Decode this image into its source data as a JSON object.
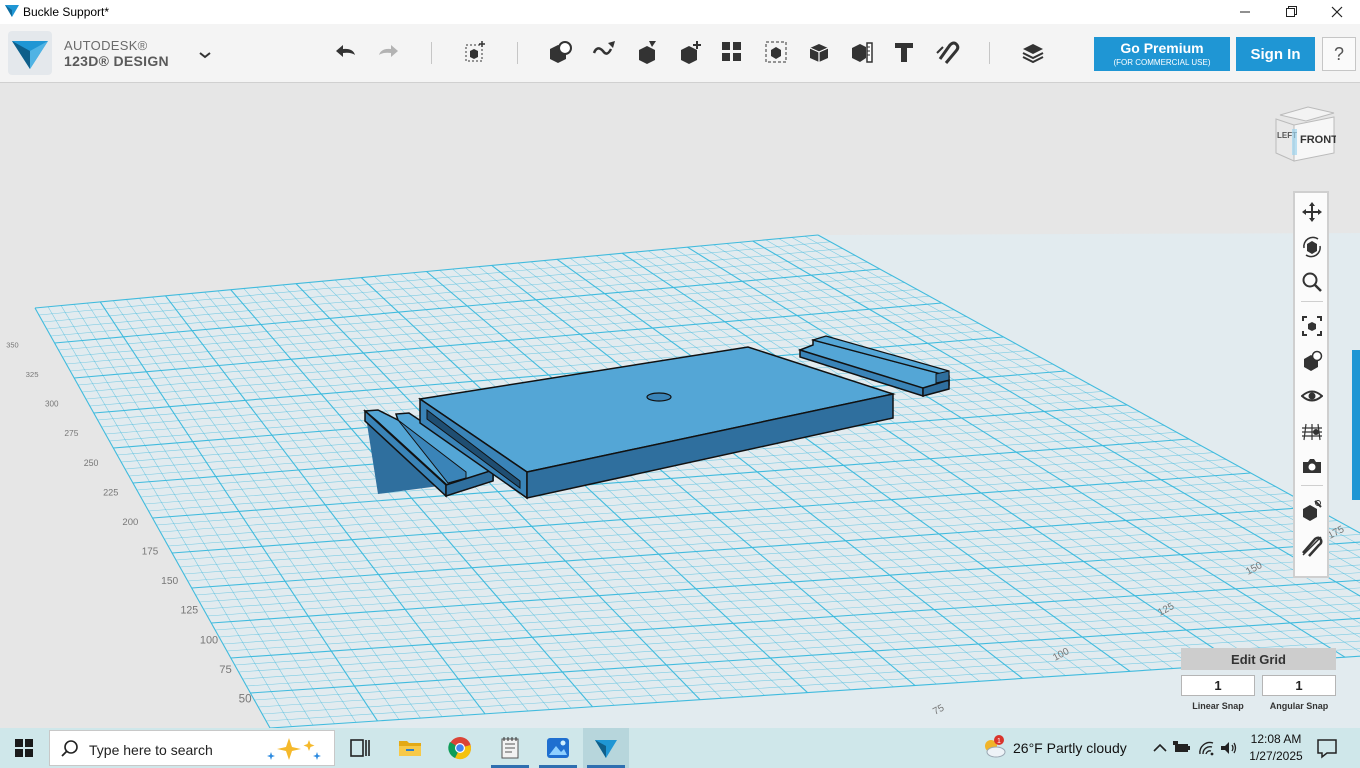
{
  "window": {
    "title": "Buckle Support*"
  },
  "brand": {
    "line1": "AUTODESK®",
    "line2": "123D® DESIGN"
  },
  "toolbar": {
    "tools": [
      "undo-icon",
      "redo-icon",
      "primitives-icon",
      "sketch-icon",
      "construct-icon",
      "modify-icon",
      "pattern-icon",
      "grouping-icon",
      "combine-icon",
      "measure-icon",
      "text-icon",
      "snap-icon",
      "material-icon"
    ],
    "premium_label": "Go Premium",
    "premium_sub": "(FOR COMMERCIAL USE)",
    "signin_label": "Sign In",
    "help_label": "?"
  },
  "viewcube": {
    "left_face": "LEFT",
    "front_face": "FRONT"
  },
  "grid_axis_labels": {
    "left": [
      "50",
      "75",
      "100",
      "125",
      "150",
      "175",
      "200",
      "225",
      "250",
      "275",
      "300",
      "325",
      "350"
    ],
    "right": [
      "75",
      "100",
      "125",
      "150",
      "175"
    ]
  },
  "grid_panel": {
    "title": "Edit Grid",
    "linear_value": "1",
    "angular_value": "1",
    "linear_label": "Linear Snap",
    "angular_label": "Angular Snap"
  },
  "taskbar": {
    "search_placeholder": "Type here to search",
    "weather": "26°F  Partly cloudy",
    "weather_badge": "1",
    "time": "12:08 AM",
    "date": "1/27/2025"
  },
  "colors": {
    "accent": "#1f96d4",
    "model_top": "#54a6d6",
    "model_side": "#2f6f9e",
    "grid_line": "#38b8dc"
  }
}
